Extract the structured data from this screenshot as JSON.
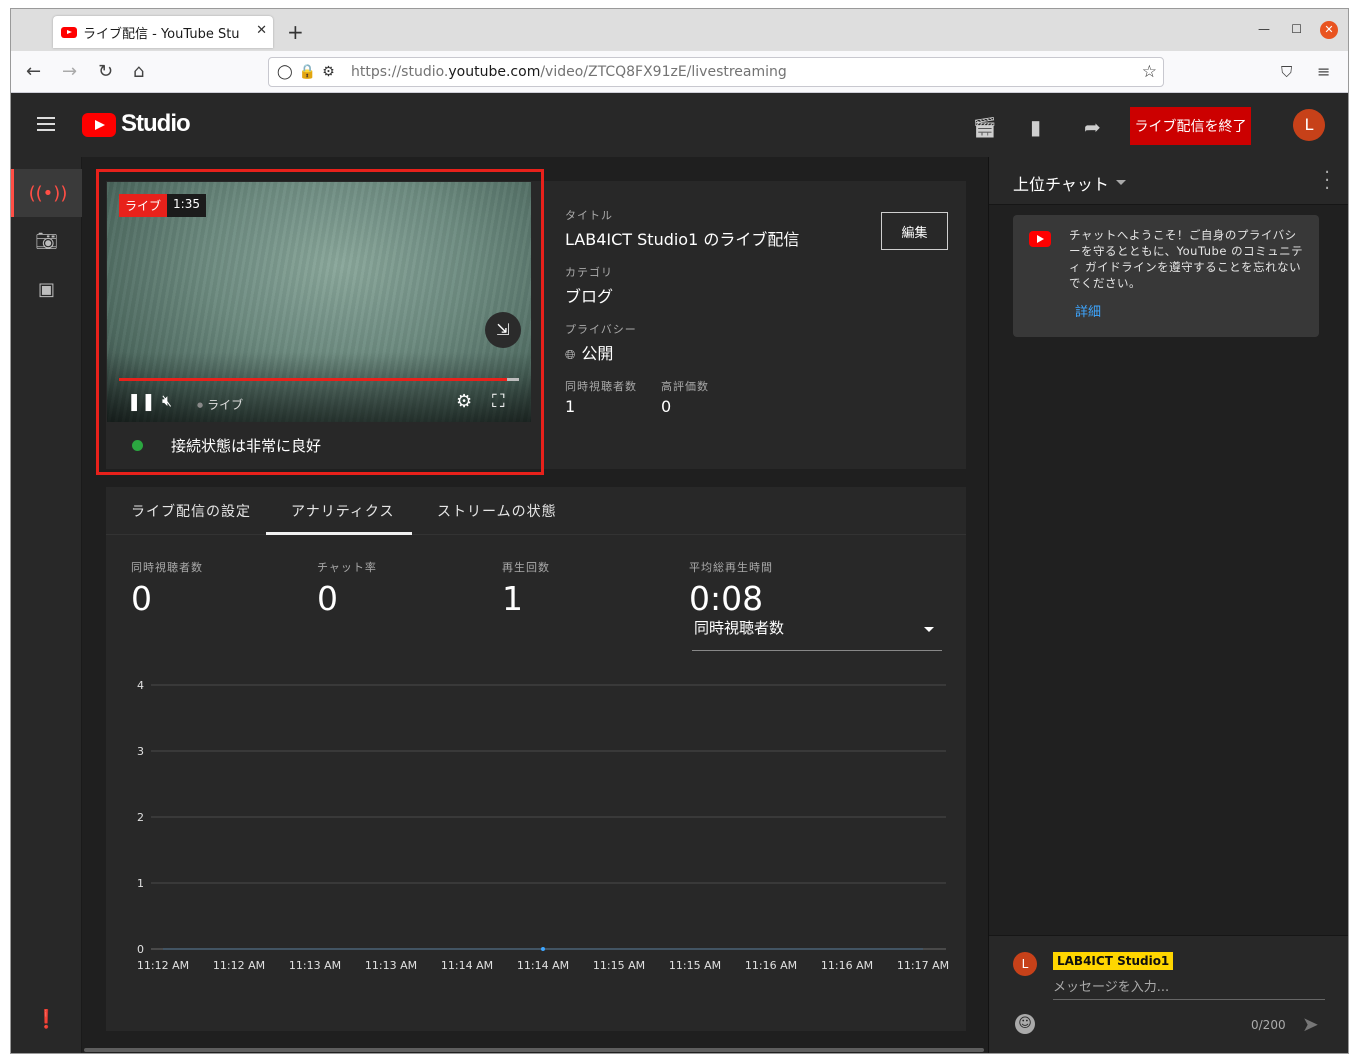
{
  "browser": {
    "tab_title": "ライブ配信 - YouTube Stu",
    "url_prefix": "https://studio.",
    "url_domain": "youtube.com",
    "url_path": "/video/ZTCQ8FX91zE/livestreaming"
  },
  "header": {
    "logo_text": "Studio",
    "end_stream_label": "ライブ配信を終了",
    "avatar_letter": "L",
    "brand_color": "#ff0000"
  },
  "player": {
    "live_label": "ライブ",
    "elapsed": "1:35",
    "controls_live_label": "ライブ",
    "progress_fraction": 0.97,
    "connection_status": "接続状態は非常に良好",
    "status_color": "#2ba640"
  },
  "details": {
    "title_label": "タイトル",
    "title_value": "LAB4ICT Studio1 のライブ配信",
    "edit_label": "編集",
    "category_label": "カテゴリ",
    "category_value": "ブログ",
    "privacy_label": "プライバシー",
    "privacy_value": "公開",
    "viewers_label": "同時視聴者数",
    "viewers_value": "1",
    "likes_label": "高評価数",
    "likes_value": "0"
  },
  "tabs": [
    "ライブ配信の設定",
    "アナリティクス",
    "ストリームの状態"
  ],
  "metrics": [
    {
      "label": "同時視聴者数",
      "value": "0"
    },
    {
      "label": "チャット率",
      "value": "0"
    },
    {
      "label": "再生回数",
      "value": "1"
    },
    {
      "label": "平均総再生時間",
      "value": "0:08"
    }
  ],
  "metric_dropdown": "同時視聴者数",
  "chart_data": {
    "type": "line",
    "title": "",
    "xlabel": "",
    "ylabel": "",
    "ylim": [
      0,
      4
    ],
    "yticks": [
      "0",
      "1",
      "2",
      "3",
      "4"
    ],
    "categories": [
      "11:12 AM",
      "11:12 AM",
      "11:13 AM",
      "11:13 AM",
      "11:14 AM",
      "11:14 AM",
      "11:15 AM",
      "11:15 AM",
      "11:16 AM",
      "11:16 AM",
      "11:17 AM"
    ],
    "series": [
      {
        "values": [
          0,
          0,
          0,
          0,
          0,
          0,
          0,
          0,
          0,
          0,
          0
        ],
        "color": "#3ea6ff"
      }
    ],
    "grid": true
  },
  "chat": {
    "title": "上位チャット",
    "welcome_text": "チャットへようこそ！ご自身のプライバシーを守るとともに、YouTube のコミュニティ ガイドラインを遵守することを忘れないでください。",
    "welcome_link": "詳細",
    "author_avatar": "L",
    "author_name": "LAB4ICT Studio1",
    "input_placeholder": "メッセージを入力...",
    "char_count": "0/200"
  }
}
